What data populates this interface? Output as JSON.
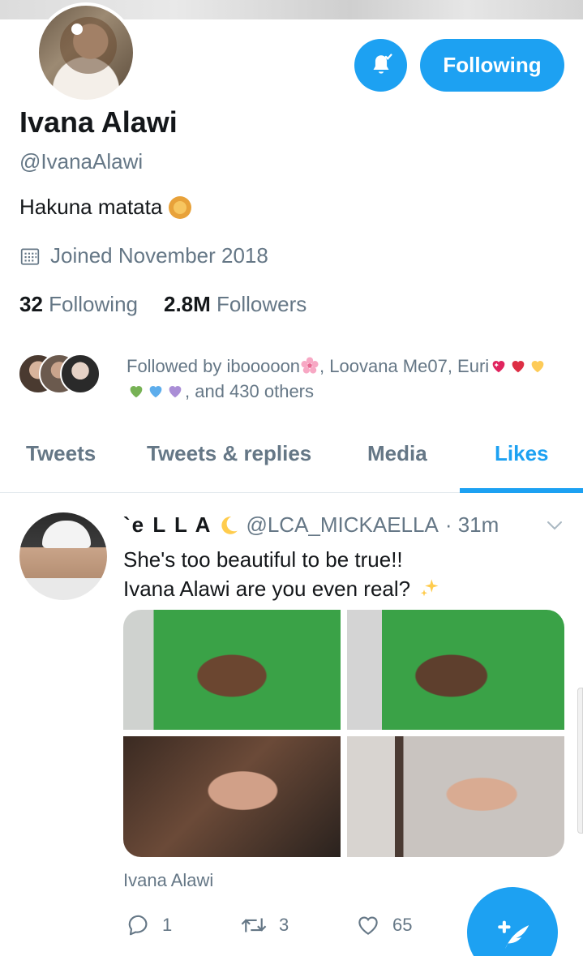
{
  "profile": {
    "display_name": "Ivana Alawi",
    "handle": "@IvanaAlawi",
    "bio": "Hakuna matata",
    "joined": "Joined November 2018",
    "following_count": "32",
    "following_label": "Following",
    "followers_count": "2.8M",
    "followers_label": "Followers"
  },
  "header": {
    "follow_button_label": "Following",
    "bell_icon": "bell-check-icon"
  },
  "followed_by": {
    "line1": "Followed by ibooooon",
    "sep1": ", Loovana Me07, Euri",
    "line2_suffix": ", and 430 others"
  },
  "tabs": [
    {
      "label": "Tweets"
    },
    {
      "label": "Tweets & replies"
    },
    {
      "label": "Media"
    },
    {
      "label": "Likes"
    }
  ],
  "active_tab": "Likes",
  "tweet": {
    "name": "`e L L A",
    "handle": "@LCA_MICKAELLA",
    "time": "· 31m",
    "text_line1": "She's too beautiful to be true!!",
    "text_line2": "Ivana Alawi are you even real?",
    "media_caption": "Ivana Alawi",
    "reply_count": "1",
    "retweet_count": "3",
    "like_count": "65"
  },
  "colors": {
    "accent": "#1da1f2",
    "text": "#14171a",
    "muted": "#657786"
  }
}
